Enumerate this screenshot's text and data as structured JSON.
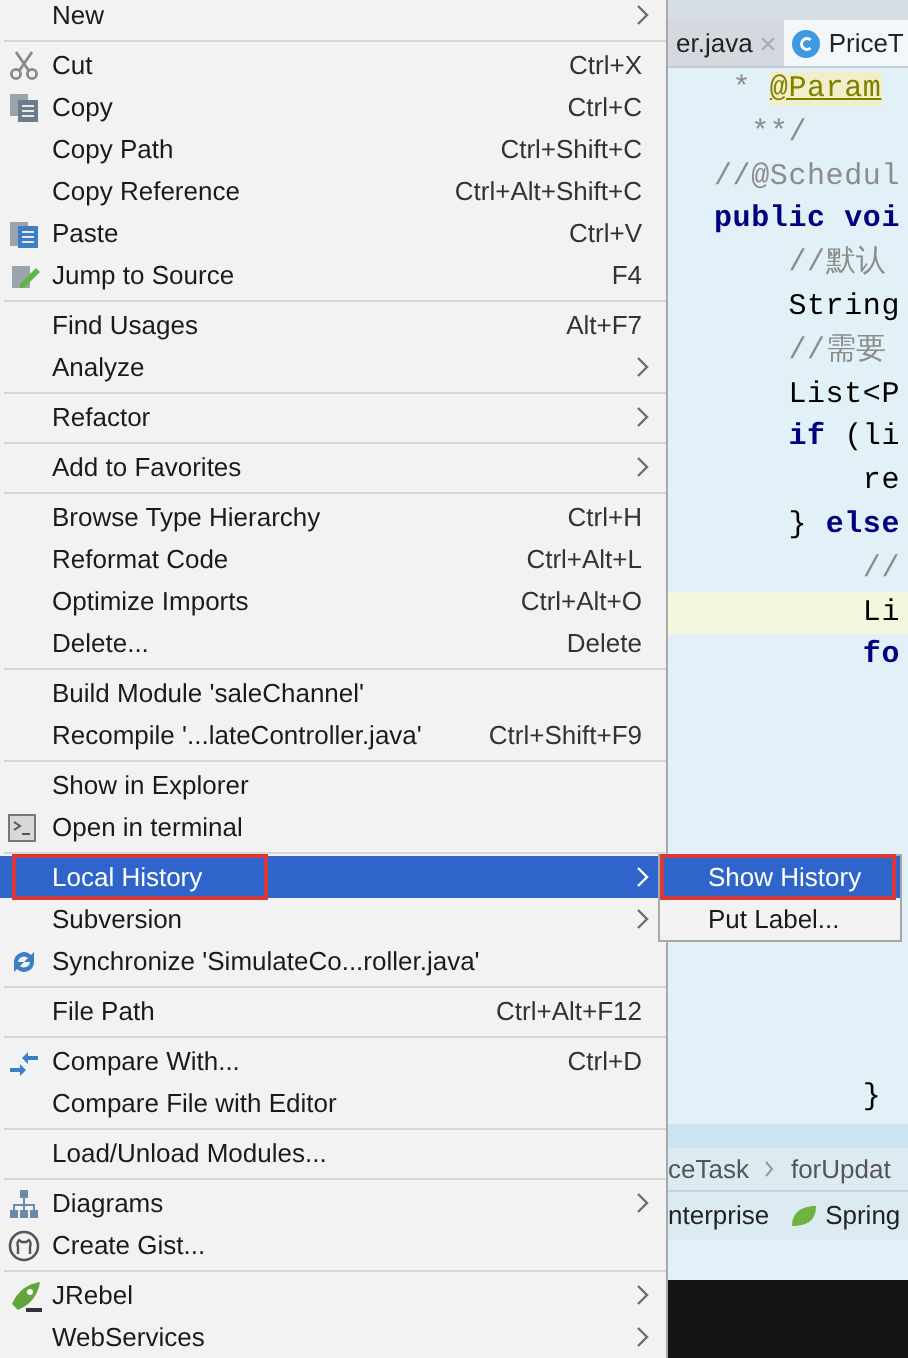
{
  "context_menu": {
    "groups": [
      [
        {
          "label": "New",
          "submenu": true,
          "selected": false,
          "highlighted": false
        }
      ],
      [
        {
          "label": "Cut",
          "shortcut": "Ctrl+X",
          "submenu": false,
          "selected": false,
          "highlighted": false
        },
        {
          "label": "Copy",
          "shortcut": "Ctrl+C",
          "submenu": false,
          "selected": false,
          "highlighted": false
        },
        {
          "label": "Copy Path",
          "shortcut": "Ctrl+Shift+C",
          "submenu": false,
          "selected": false,
          "highlighted": false
        },
        {
          "label": "Copy Reference",
          "shortcut": "Ctrl+Alt+Shift+C",
          "submenu": false,
          "selected": false,
          "highlighted": false
        },
        {
          "label": "Paste",
          "shortcut": "Ctrl+V",
          "submenu": false,
          "selected": false,
          "highlighted": false
        },
        {
          "label": "Jump to Source",
          "shortcut": "F4",
          "submenu": false,
          "selected": false,
          "highlighted": false
        }
      ],
      [
        {
          "label": "Find Usages",
          "shortcut": "Alt+F7",
          "submenu": false,
          "selected": false,
          "highlighted": false
        },
        {
          "label": "Analyze",
          "submenu": true,
          "selected": false,
          "highlighted": false
        }
      ],
      [
        {
          "label": "Refactor",
          "submenu": true,
          "selected": false,
          "highlighted": false
        }
      ],
      [
        {
          "label": "Add to Favorites",
          "submenu": true,
          "selected": false,
          "highlighted": false
        }
      ],
      [
        {
          "label": "Browse Type Hierarchy",
          "shortcut": "Ctrl+H",
          "submenu": false,
          "selected": false,
          "highlighted": false
        },
        {
          "label": "Reformat Code",
          "shortcut": "Ctrl+Alt+L",
          "submenu": false,
          "selected": false,
          "highlighted": false
        },
        {
          "label": "Optimize Imports",
          "shortcut": "Ctrl+Alt+O",
          "submenu": false,
          "selected": false,
          "highlighted": false
        },
        {
          "label": "Delete...",
          "shortcut": "Delete",
          "submenu": false,
          "selected": false,
          "highlighted": false
        }
      ],
      [
        {
          "label": "Build Module 'saleChannel'",
          "submenu": false,
          "selected": false,
          "highlighted": false
        },
        {
          "label": "Recompile '...lateController.java'",
          "shortcut": "Ctrl+Shift+F9",
          "submenu": false,
          "selected": false,
          "highlighted": false
        }
      ],
      [
        {
          "label": "Show in Explorer",
          "submenu": false,
          "selected": false,
          "highlighted": false
        },
        {
          "label": "Open in terminal",
          "submenu": false,
          "selected": false,
          "highlighted": false
        }
      ],
      [
        {
          "label": "Local History",
          "submenu": true,
          "selected": true,
          "highlighted": true
        },
        {
          "label": "Subversion",
          "submenu": true,
          "selected": false,
          "highlighted": false
        },
        {
          "label": "Synchronize 'SimulateCo...roller.java'",
          "submenu": false,
          "selected": false,
          "highlighted": false
        }
      ],
      [
        {
          "label": "File Path",
          "shortcut": "Ctrl+Alt+F12",
          "submenu": false,
          "selected": false,
          "highlighted": false
        }
      ],
      [
        {
          "label": "Compare With...",
          "shortcut": "Ctrl+D",
          "submenu": false,
          "selected": false,
          "highlighted": false
        },
        {
          "label": "Compare File with Editor",
          "submenu": false,
          "selected": false,
          "highlighted": false
        }
      ],
      [
        {
          "label": "Load/Unload Modules...",
          "submenu": false,
          "selected": false,
          "highlighted": false
        }
      ],
      [
        {
          "label": "Diagrams",
          "submenu": true,
          "selected": false,
          "highlighted": false
        },
        {
          "label": "Create Gist...",
          "submenu": false,
          "selected": false,
          "highlighted": false
        }
      ],
      [
        {
          "label": "JRebel",
          "submenu": true,
          "selected": false,
          "highlighted": false
        },
        {
          "label": "WebServices",
          "submenu": true,
          "selected": false,
          "highlighted": false
        }
      ]
    ]
  },
  "submenu": {
    "items": [
      {
        "label": "Show History",
        "selected": true,
        "highlighted": true
      },
      {
        "label": "Put Label...",
        "selected": false,
        "highlighted": false
      }
    ]
  },
  "editor": {
    "tabs": [
      {
        "label": "er.java",
        "selected": false
      },
      {
        "label": "PriceT",
        "selected": true
      }
    ],
    "lines": [
      [
        {
          "kind": "comment",
          "text": " * "
        },
        {
          "kind": "annotation",
          "text": "@Param"
        }
      ],
      [
        {
          "kind": "comment",
          "text": "  **/"
        }
      ],
      [
        {
          "kind": "comment",
          "text": "//@Schedul"
        }
      ],
      [
        {
          "kind": "keyword",
          "text": "public voi"
        }
      ],
      [
        {
          "kind": "comment",
          "text": "    //默认"
        }
      ],
      [
        {
          "kind": "plain",
          "text": "    String"
        }
      ],
      [
        {
          "kind": "comment",
          "text": "    //需要"
        }
      ],
      [
        {
          "kind": "plain",
          "text": "    List<P"
        }
      ],
      [
        {
          "kind": "keyword",
          "text": "    if"
        },
        {
          "kind": "plain",
          "text": " (li"
        }
      ],
      [
        {
          "kind": "plain",
          "text": "        re"
        }
      ],
      [
        {
          "kind": "plain",
          "text": "    } "
        },
        {
          "kind": "keyword",
          "text": "else"
        }
      ],
      [
        {
          "kind": "comment",
          "text": "        //"
        }
      ],
      [
        {
          "kind": "plain",
          "text": "        Li"
        }
      ],
      [
        {
          "kind": "keyword",
          "text": "        fo"
        }
      ]
    ],
    "closing_line": "        }",
    "breadcrumbs": [
      "ceTask",
      "forUpdat"
    ],
    "tool_tabs": [
      {
        "label": "nterprise"
      },
      {
        "label": "Spring"
      }
    ]
  }
}
